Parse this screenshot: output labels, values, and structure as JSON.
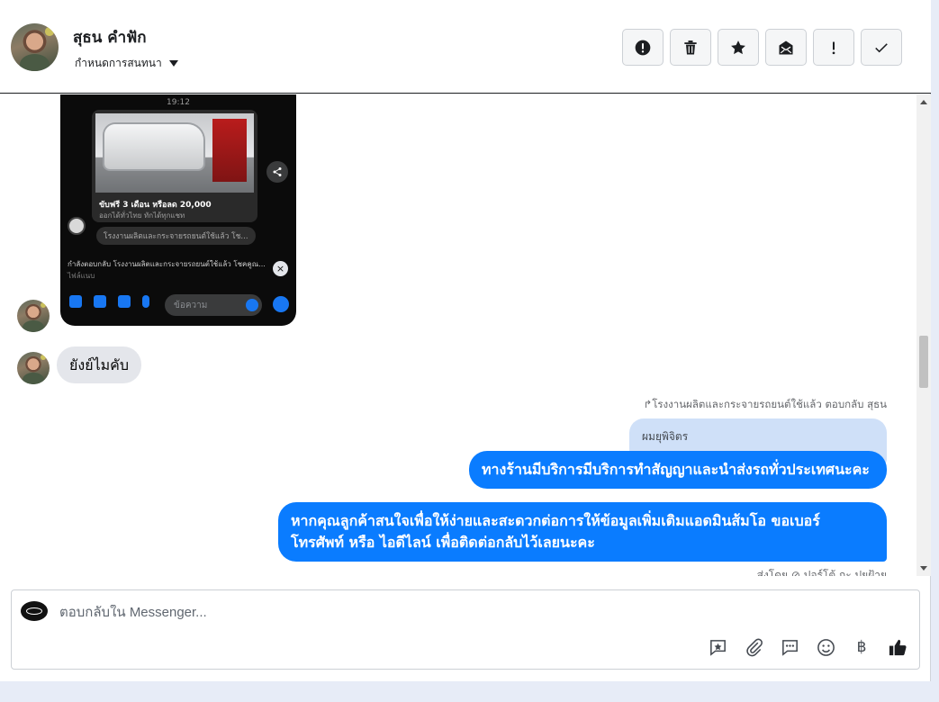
{
  "header": {
    "contact_name": "สุธน คำฟัก",
    "conversation_settings": "กำหนดการสนทนา",
    "actions": [
      {
        "icon": "alert-circle-icon",
        "label": "!"
      },
      {
        "icon": "trash-icon",
        "label": ""
      },
      {
        "icon": "star-icon",
        "label": ""
      },
      {
        "icon": "mark-unread-icon",
        "label": ""
      },
      {
        "icon": "exclamation-icon",
        "label": "!"
      },
      {
        "icon": "check-icon",
        "label": ""
      }
    ]
  },
  "thread": {
    "phone_screenshot": {
      "time": "19:12",
      "card_title": "ขับฟรี 3 เดือน หรือลด 20,000",
      "card_subtitle": "ออกได้ทั่วไทย ทักได้ทุกแชท",
      "page_chip": "โรงงานผลิตและกระจายรถยนต์ใช้แล้ว โช...",
      "replying_to": "กำลังตอบกลับ โรงงานผลิตและกระจายรถยนต์ใช้แล้ว โชคคูณ...",
      "replying_sub": "ไฟล์แนบ",
      "input_placeholder": "ข้อความ"
    },
    "incoming_text": "ยังย์ไมคับ",
    "reply_note": "โรงงานผลิตและกระจายรถยนต์ใช้แล้ว ตอบกลับ สุธน",
    "quoted_text": "ผมยุพิจิตร",
    "outgoing": [
      "ทางร้านมีบริการมีบริการทำสัญญาและนำส่งรถทั่วประเทศนะคะ",
      "หากคุณลูกค้าสนใจเพื่อให้ง่ายและสะดวกต่อการให้ข้อมูลเพิ่มเติมแอดมินส้มโอ ขอเบอร์ โทรศัพท์ หรือ ไอดีไลน์ เพื่อติดต่อกลับไว้เลยนะคะ"
    ],
    "sent_by": "ส่งโดย ⊘ ปอร์โต้ กะ ปุยฝ้าย"
  },
  "composer": {
    "placeholder": "ตอบกลับใน Messenger...",
    "currency_symbol": "฿"
  },
  "colors": {
    "outgoing_bubble": "#0a7cff",
    "incoming_bubble": "#e4e6eb",
    "quoted_bubble": "#cfe0f8"
  }
}
